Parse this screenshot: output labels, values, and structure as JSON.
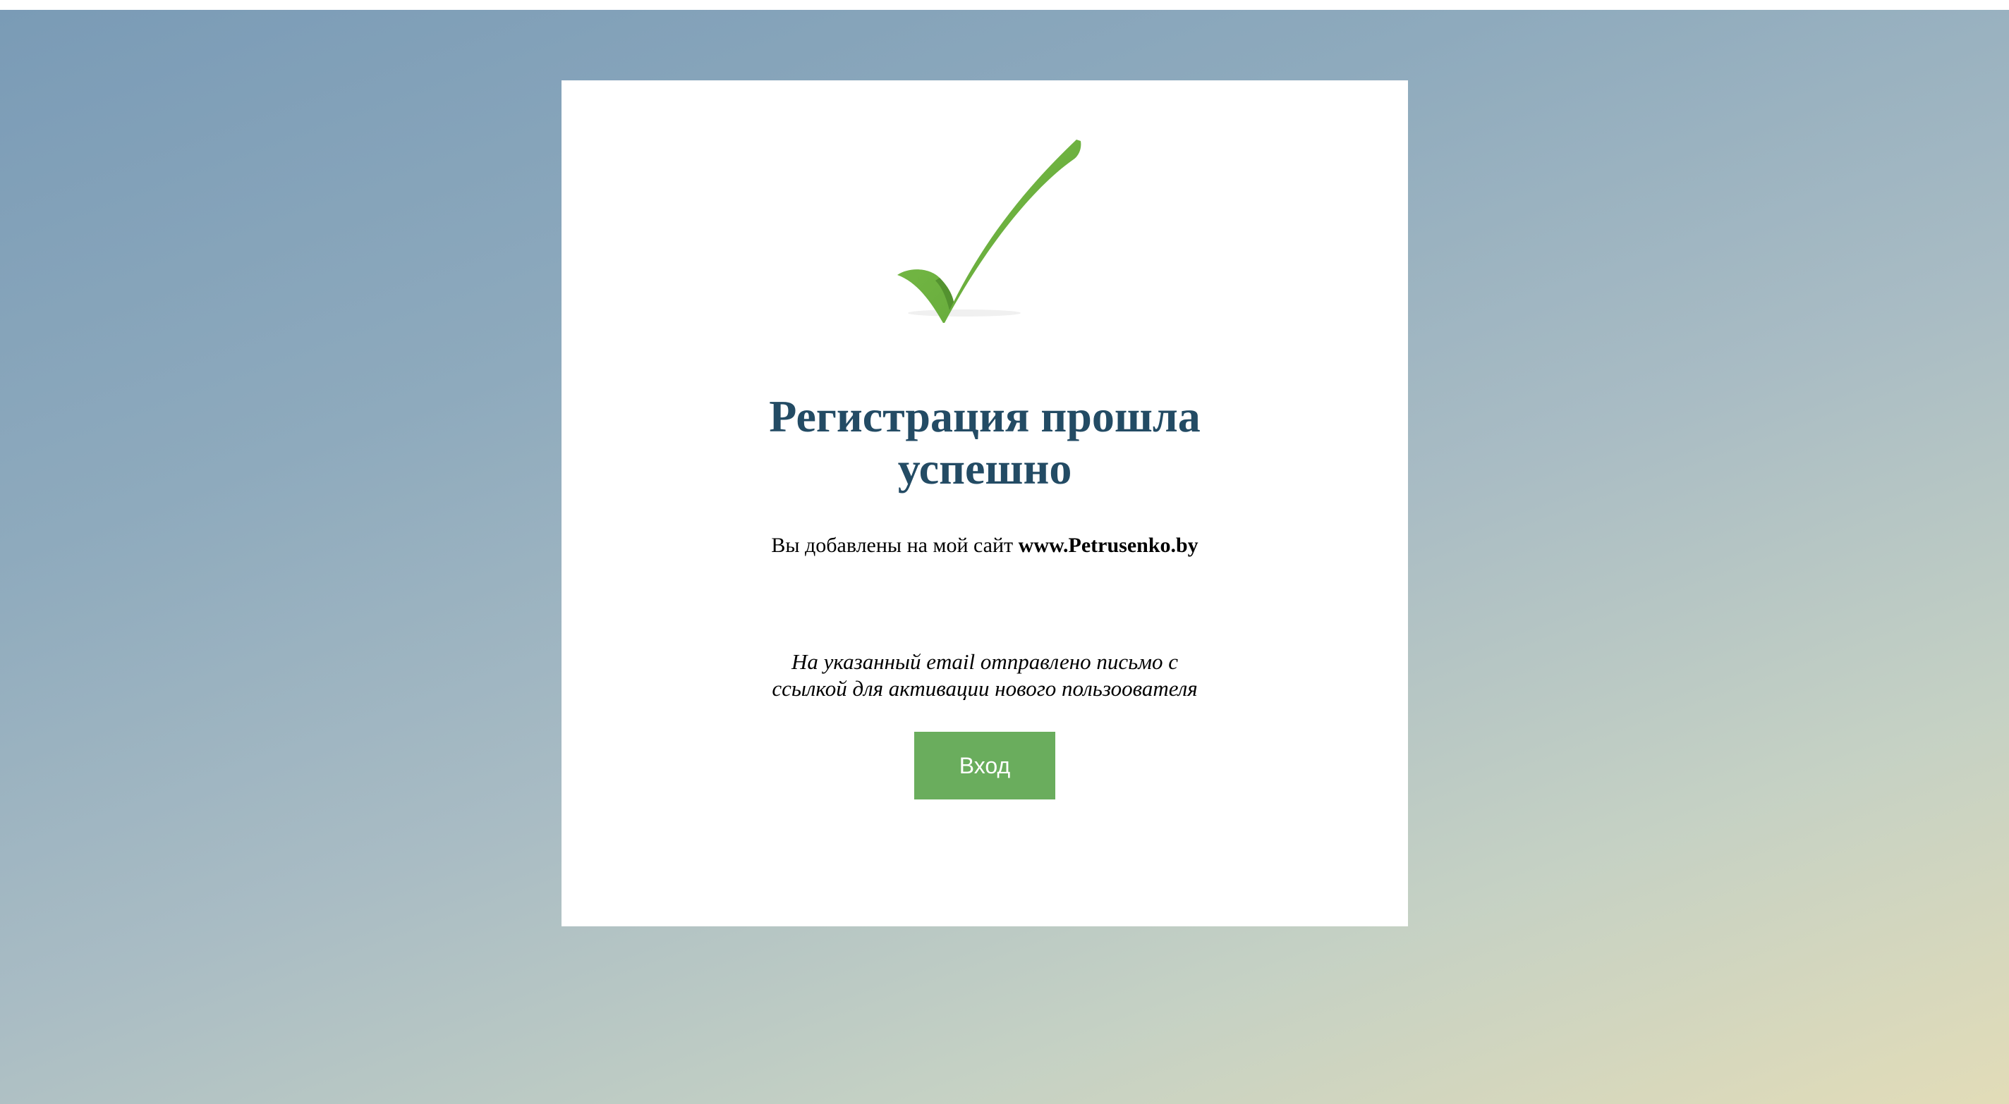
{
  "card": {
    "title_line1": "Регистрация прошла",
    "title_line2": "успешно",
    "subtitle_text": "Вы добавлены на мой сайт ",
    "subtitle_site": "www.Petrusenko.by",
    "notice_line1": "На указанный email отправлено письмо с",
    "notice_line2": "ссылкой для активации нового пользоователя",
    "login_button_label": "Вход"
  },
  "icons": {
    "success": "checkmark-icon"
  },
  "colors": {
    "title": "#234b64",
    "button": "#6aad5d",
    "checkmark": "#6cb33f"
  }
}
